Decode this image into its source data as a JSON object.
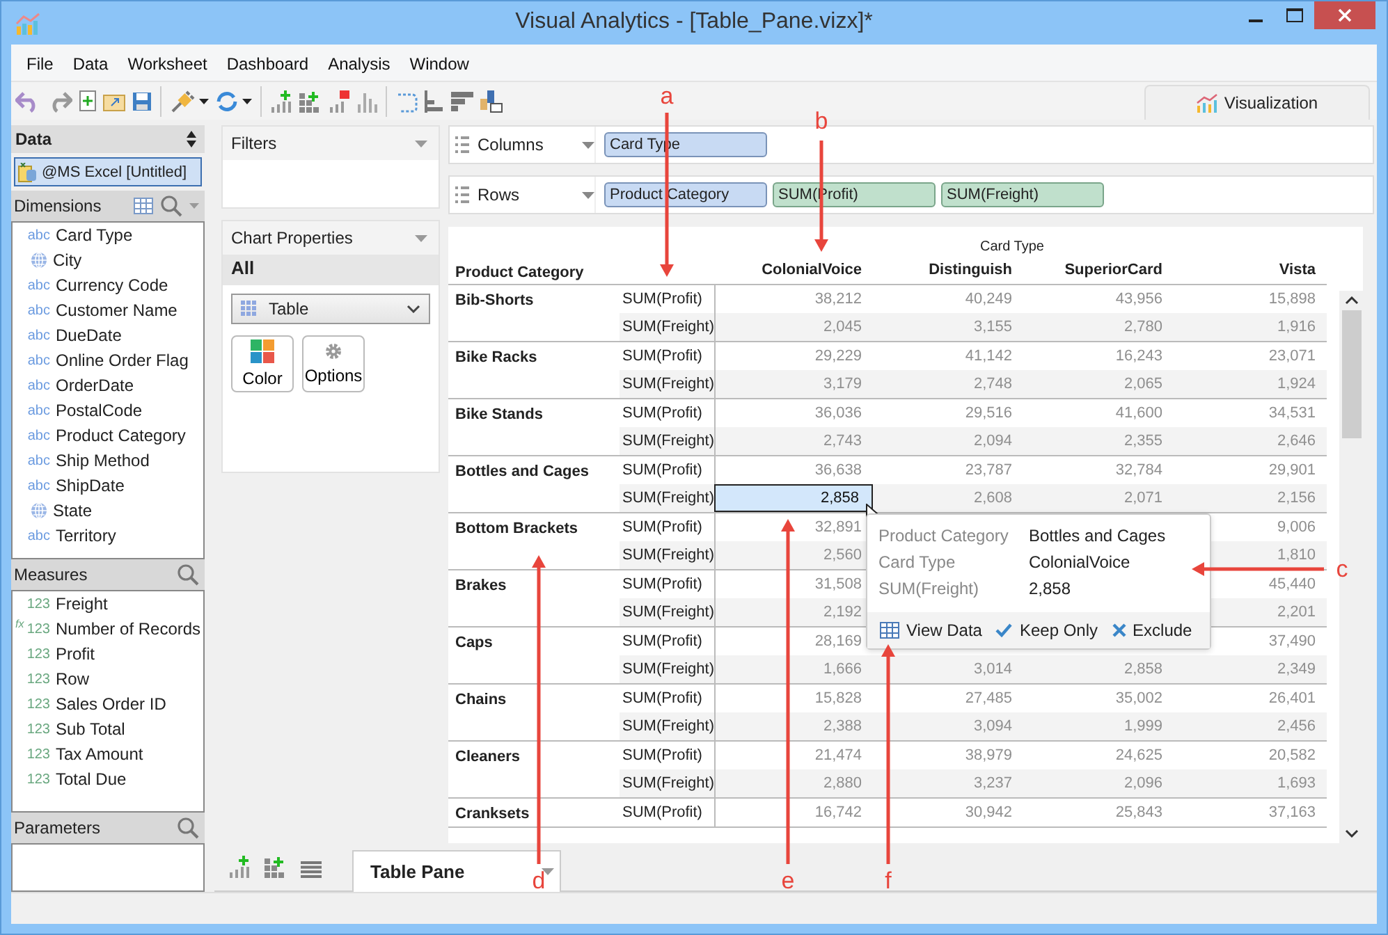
{
  "window": {
    "title": "Visual Analytics - [Table_Pane.vizx]*"
  },
  "menu": [
    "File",
    "Data",
    "Worksheet",
    "Dashboard",
    "Analysis",
    "Window"
  ],
  "view_tab": {
    "label": "Visualization"
  },
  "data_panel": {
    "title": "Data",
    "source": {
      "label": "@MS Excel [Untitled]",
      "selected": true
    }
  },
  "dimensions": {
    "title": "Dimensions",
    "items": [
      {
        "name": "Card Type",
        "kind": "text",
        "badge": "abc"
      },
      {
        "name": "City",
        "kind": "geo"
      },
      {
        "name": "Currency Code",
        "kind": "text",
        "badge": "abc"
      },
      {
        "name": "Customer Name",
        "kind": "text",
        "badge": "abc"
      },
      {
        "name": "DueDate",
        "kind": "text",
        "badge": "abc"
      },
      {
        "name": "Online Order Flag",
        "kind": "text",
        "badge": "abc"
      },
      {
        "name": "OrderDate",
        "kind": "text",
        "badge": "abc"
      },
      {
        "name": "PostalCode",
        "kind": "text",
        "badge": "abc"
      },
      {
        "name": "Product Category",
        "kind": "text",
        "badge": "abc"
      },
      {
        "name": "Ship Method",
        "kind": "text",
        "badge": "abc"
      },
      {
        "name": "ShipDate",
        "kind": "text",
        "badge": "abc"
      },
      {
        "name": "State",
        "kind": "geo"
      },
      {
        "name": "Territory",
        "kind": "text",
        "badge": "abc"
      }
    ]
  },
  "measures": {
    "title": "Measures",
    "items": [
      {
        "name": "Freight",
        "kind": "number",
        "badge": "123"
      },
      {
        "name": "Number of Records",
        "kind": "calc",
        "mark": "fx",
        "badge": "123"
      },
      {
        "name": "Profit",
        "kind": "number",
        "badge": "123"
      },
      {
        "name": "Row",
        "kind": "number",
        "badge": "123"
      },
      {
        "name": "Sales Order ID",
        "kind": "number",
        "badge": "123"
      },
      {
        "name": "Sub Total",
        "kind": "number",
        "badge": "123"
      },
      {
        "name": "Tax Amount",
        "kind": "number",
        "badge": "123"
      },
      {
        "name": "Total Due",
        "kind": "number",
        "badge": "123"
      }
    ]
  },
  "parameters": {
    "title": "Parameters"
  },
  "filters": {
    "title": "Filters"
  },
  "chart_properties": {
    "title": "Chart Properties",
    "scope": "All",
    "chart_type": "Table",
    "buttons": [
      {
        "label": "Color",
        "kind": "color"
      },
      {
        "label": "Options",
        "kind": "options"
      }
    ]
  },
  "shelves": [
    {
      "label": "Columns",
      "pills": [
        {
          "text": "Card Type",
          "kind": "dimension"
        }
      ]
    },
    {
      "label": "Rows",
      "pills": [
        {
          "text": "Product Category",
          "kind": "dimension"
        },
        {
          "text": "SUM(Profit)",
          "kind": "measure"
        },
        {
          "text": "SUM(Freight)",
          "kind": "measure"
        }
      ]
    }
  ],
  "table": {
    "column_group": "Card Type",
    "row_header": "Product Category",
    "columns": [
      "ColonialVoice",
      "Distinguish",
      "SuperiorCard",
      "Vista"
    ],
    "groups": [
      {
        "category": "Bib-Shorts",
        "rows": [
          {
            "measure": "SUM(Profit)",
            "cells": [
              {
                "text": "38,212",
                "selected": false
              },
              {
                "text": "40,249",
                "selected": false
              },
              {
                "text": "43,956",
                "selected": false
              },
              {
                "text": "15,898",
                "selected": false
              }
            ]
          },
          {
            "measure": "SUM(Freight)",
            "cells": [
              {
                "text": "2,045",
                "selected": false
              },
              {
                "text": "3,155",
                "selected": false
              },
              {
                "text": "2,780",
                "selected": false
              },
              {
                "text": "1,916",
                "selected": false
              }
            ]
          }
        ]
      },
      {
        "category": "Bike Racks",
        "rows": [
          {
            "measure": "SUM(Profit)",
            "cells": [
              {
                "text": "29,229",
                "selected": false
              },
              {
                "text": "41,142",
                "selected": false
              },
              {
                "text": "16,243",
                "selected": false
              },
              {
                "text": "23,071",
                "selected": false
              }
            ]
          },
          {
            "measure": "SUM(Freight)",
            "cells": [
              {
                "text": "3,179",
                "selected": false
              },
              {
                "text": "2,748",
                "selected": false
              },
              {
                "text": "2,065",
                "selected": false
              },
              {
                "text": "1,924",
                "selected": false
              }
            ]
          }
        ]
      },
      {
        "category": "Bike Stands",
        "rows": [
          {
            "measure": "SUM(Profit)",
            "cells": [
              {
                "text": "36,036",
                "selected": false
              },
              {
                "text": "29,516",
                "selected": false
              },
              {
                "text": "41,600",
                "selected": false
              },
              {
                "text": "34,531",
                "selected": false
              }
            ]
          },
          {
            "measure": "SUM(Freight)",
            "cells": [
              {
                "text": "2,743",
                "selected": false
              },
              {
                "text": "2,094",
                "selected": false
              },
              {
                "text": "2,355",
                "selected": false
              },
              {
                "text": "2,646",
                "selected": false
              }
            ]
          }
        ]
      },
      {
        "category": "Bottles and Cages",
        "rows": [
          {
            "measure": "SUM(Profit)",
            "cells": [
              {
                "text": "36,638",
                "selected": false
              },
              {
                "text": "23,787",
                "selected": false
              },
              {
                "text": "32,784",
                "selected": false
              },
              {
                "text": "29,901",
                "selected": false
              }
            ]
          },
          {
            "measure": "SUM(Freight)",
            "cells": [
              {
                "text": "2,858",
                "selected": true
              },
              {
                "text": "2,608",
                "selected": false
              },
              {
                "text": "2,071",
                "selected": false
              },
              {
                "text": "2,156",
                "selected": false
              }
            ]
          }
        ]
      },
      {
        "category": "Bottom Brackets",
        "rows": [
          {
            "measure": "SUM(Profit)",
            "cells": [
              {
                "text": "32,891",
                "selected": false
              },
              null,
              null,
              {
                "text": "9,006",
                "selected": false
              }
            ]
          },
          {
            "measure": "SUM(Freight)",
            "cells": [
              {
                "text": "2,560",
                "selected": false
              },
              null,
              null,
              {
                "text": "1,810",
                "selected": false
              }
            ]
          }
        ]
      },
      {
        "category": "Brakes",
        "rows": [
          {
            "measure": "SUM(Profit)",
            "cells": [
              {
                "text": "31,508",
                "selected": false
              },
              null,
              null,
              {
                "text": "45,440",
                "selected": false
              }
            ]
          },
          {
            "measure": "SUM(Freight)",
            "cells": [
              {
                "text": "2,192",
                "selected": false
              },
              null,
              null,
              {
                "text": "2,201",
                "selected": false
              }
            ]
          }
        ]
      },
      {
        "category": "Caps",
        "rows": [
          {
            "measure": "SUM(Profit)",
            "cells": [
              {
                "text": "28,169",
                "selected": false
              },
              null,
              null,
              {
                "text": "37,490",
                "selected": false
              }
            ]
          },
          {
            "measure": "SUM(Freight)",
            "cells": [
              {
                "text": "1,666",
                "selected": false
              },
              {
                "text": "3,014",
                "selected": false
              },
              {
                "text": "2,858",
                "selected": false
              },
              {
                "text": "2,349",
                "selected": false
              }
            ]
          }
        ]
      },
      {
        "category": "Chains",
        "rows": [
          {
            "measure": "SUM(Profit)",
            "cells": [
              {
                "text": "15,828",
                "selected": false
              },
              {
                "text": "27,485",
                "selected": false
              },
              {
                "text": "35,002",
                "selected": false
              },
              {
                "text": "26,401",
                "selected": false
              }
            ]
          },
          {
            "measure": "SUM(Freight)",
            "cells": [
              {
                "text": "2,388",
                "selected": false
              },
              {
                "text": "3,094",
                "selected": false
              },
              {
                "text": "1,999",
                "selected": false
              },
              {
                "text": "2,456",
                "selected": false
              }
            ]
          }
        ]
      },
      {
        "category": "Cleaners",
        "rows": [
          {
            "measure": "SUM(Profit)",
            "cells": [
              {
                "text": "21,474",
                "selected": false
              },
              {
                "text": "38,979",
                "selected": false
              },
              {
                "text": "24,625",
                "selected": false
              },
              {
                "text": "20,582",
                "selected": false
              }
            ]
          },
          {
            "measure": "SUM(Freight)",
            "cells": [
              {
                "text": "2,880",
                "selected": false
              },
              {
                "text": "3,237",
                "selected": false
              },
              {
                "text": "2,096",
                "selected": false
              },
              {
                "text": "1,693",
                "selected": false
              }
            ]
          }
        ]
      },
      {
        "category": "Cranksets",
        "rows": [
          {
            "measure": "SUM(Profit)",
            "cells": [
              {
                "text": "16,742",
                "selected": false
              },
              {
                "text": "30,942",
                "selected": false
              },
              {
                "text": "25,843",
                "selected": false
              },
              {
                "text": "37,163",
                "selected": false
              }
            ]
          }
        ]
      }
    ]
  },
  "tooltip": {
    "fields": [
      {
        "label": "Product Category",
        "value": "Bottles and Cages"
      },
      {
        "label": "Card Type",
        "value": "ColonialVoice"
      },
      {
        "label": "SUM(Freight)",
        "value": "2,858"
      }
    ],
    "actions": [
      {
        "label": "View Data",
        "kind": "view"
      },
      {
        "label": "Keep Only",
        "kind": "keep"
      },
      {
        "label": "Exclude",
        "kind": "exclude"
      }
    ]
  },
  "sheet_tabs": [
    {
      "label": "Table Pane",
      "selected": true
    }
  ],
  "annotations": [
    {
      "label": "a"
    },
    {
      "label": "b"
    },
    {
      "label": "c"
    },
    {
      "label": "d"
    },
    {
      "label": "e"
    },
    {
      "label": "f"
    }
  ]
}
